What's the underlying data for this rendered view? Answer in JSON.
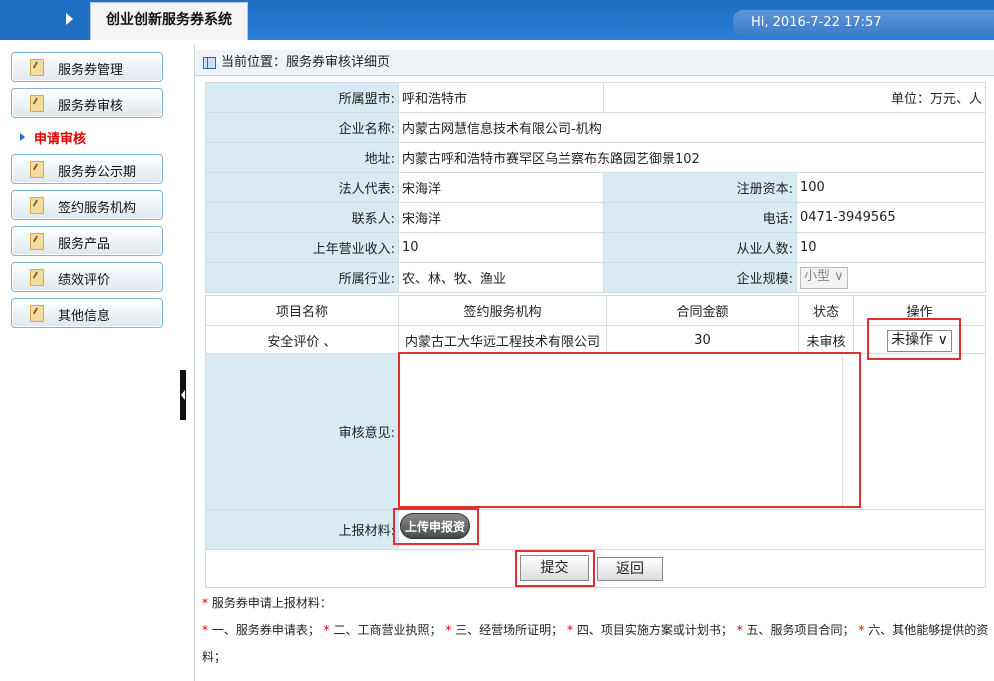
{
  "header": {
    "system_title": "创业创新服务券系统",
    "greeting": "Hi, 2016-7-22 17:57"
  },
  "sidebar": {
    "items": [
      {
        "label": "服务券管理"
      },
      {
        "label": "服务券审核"
      },
      {
        "label": "服务券公示期"
      },
      {
        "label": "签约服务机构"
      },
      {
        "label": "服务产品"
      },
      {
        "label": "绩效评价"
      },
      {
        "label": "其他信息"
      }
    ],
    "active_sub": "申请审核"
  },
  "breadcrumb": "当前位置：服务券审核详细页",
  "form": {
    "league_city_label": "所属盟市:",
    "league_city": "呼和浩特市",
    "unit": "单位：万元、人",
    "company_label": "企业名称:",
    "company": "内蒙古网慧信息技术有限公司-机构",
    "address_label": "地址:",
    "address": "内蒙古呼和浩特市赛罕区乌兰察布东路园艺御景102",
    "legal_rep_label": "法人代表:",
    "legal_rep": "宋海洋",
    "capital_label": "注册资本:",
    "capital": "100",
    "contact_label": "联系人:",
    "contact": "宋海洋",
    "phone_label": "电话:",
    "phone": "0471-3949565",
    "revenue_label": "上年营业收入:",
    "revenue": "10",
    "employees_label": "从业人数:",
    "employees": "10",
    "industry_label": "所属行业:",
    "industry": "农、林、牧、渔业",
    "scale_label": "企业规模:",
    "scale": "小型"
  },
  "project_table": {
    "headers": [
      "项目名称",
      "签约服务机构",
      "合同金额",
      "状态",
      "操作"
    ],
    "row": {
      "name": "安全评价 、",
      "agency": "内蒙古工大华远工程技术有限公司",
      "amount": "30",
      "status": "未审核",
      "action": "未操作"
    }
  },
  "review": {
    "opinion_label": "审核意见:",
    "materials_label": "上报材料:",
    "upload_button": "上传申报资"
  },
  "buttons": {
    "submit": "提交",
    "back": "返回"
  },
  "notes": {
    "title": "服务券申请上报材料：",
    "items": [
      "一、服务券申请表；",
      "二、工商营业执照；",
      "三、经营场所证明；",
      "四、项目实施方案或计划书；",
      "五、服务项目合同；",
      "六、其他能够提供的资料；"
    ]
  }
}
